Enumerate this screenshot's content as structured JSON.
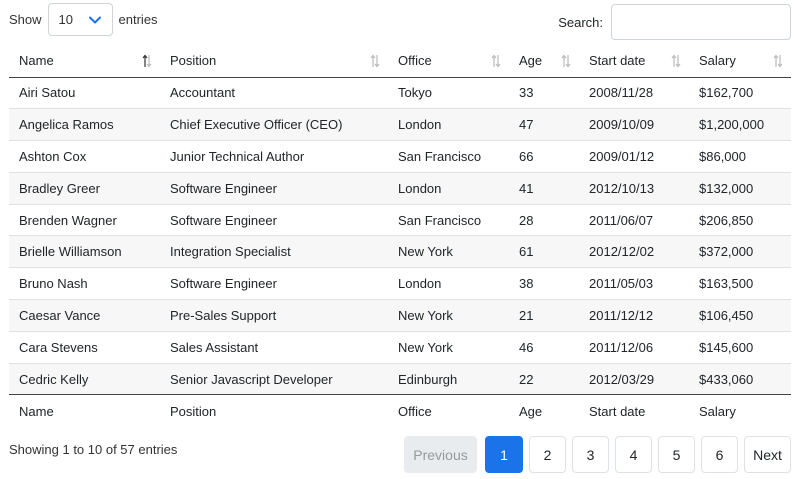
{
  "length": {
    "show_label": "Show",
    "selected": "10",
    "entries_label": "entries"
  },
  "search": {
    "label": "Search:",
    "value": "",
    "placeholder": ""
  },
  "columns": [
    "Name",
    "Position",
    "Office",
    "Age",
    "Start date",
    "Salary"
  ],
  "rows": [
    [
      "Airi Satou",
      "Accountant",
      "Tokyo",
      "33",
      "2008/11/28",
      "$162,700"
    ],
    [
      "Angelica Ramos",
      "Chief Executive Officer (CEO)",
      "London",
      "47",
      "2009/10/09",
      "$1,200,000"
    ],
    [
      "Ashton Cox",
      "Junior Technical Author",
      "San Francisco",
      "66",
      "2009/01/12",
      "$86,000"
    ],
    [
      "Bradley Greer",
      "Software Engineer",
      "London",
      "41",
      "2012/10/13",
      "$132,000"
    ],
    [
      "Brenden Wagner",
      "Software Engineer",
      "San Francisco",
      "28",
      "2011/06/07",
      "$206,850"
    ],
    [
      "Brielle Williamson",
      "Integration Specialist",
      "New York",
      "61",
      "2012/12/02",
      "$372,000"
    ],
    [
      "Bruno Nash",
      "Software Engineer",
      "London",
      "38",
      "2011/05/03",
      "$163,500"
    ],
    [
      "Caesar Vance",
      "Pre-Sales Support",
      "New York",
      "21",
      "2011/12/12",
      "$106,450"
    ],
    [
      "Cara Stevens",
      "Sales Assistant",
      "New York",
      "46",
      "2011/12/06",
      "$145,600"
    ],
    [
      "Cedric Kelly",
      "Senior Javascript Developer",
      "Edinburgh",
      "22",
      "2012/03/29",
      "$433,060"
    ]
  ],
  "info": "Showing 1 to 10 of 57 entries",
  "pagination": {
    "previous": "Previous",
    "next": "Next",
    "current": "1",
    "pages": [
      "1",
      "2",
      "3",
      "4",
      "5",
      "6"
    ]
  },
  "colors": {
    "accent": "#1a73e8",
    "striped_row": "#f7f7f7",
    "disabled_bg": "#e9ecef"
  },
  "icons": {
    "length_dropdown": "chevron-down-icon",
    "sort": "sort-arrows-icon"
  }
}
